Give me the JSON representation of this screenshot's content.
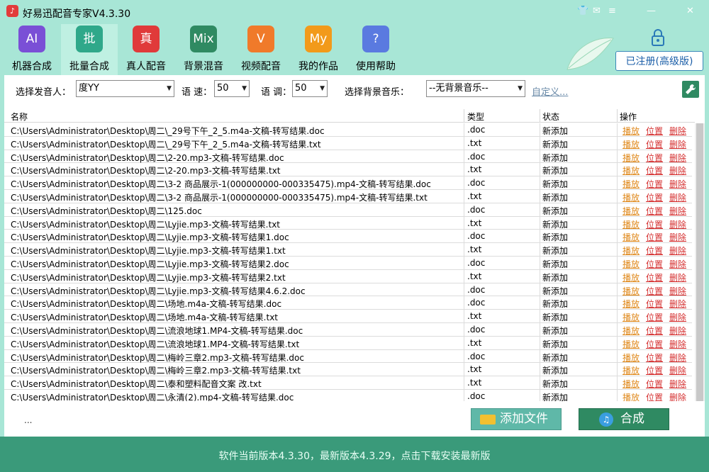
{
  "app": {
    "title": "好易迅配音专家V4.3.30"
  },
  "window_controls": [
    "👕",
    "✉",
    "≡",
    "—",
    "✕"
  ],
  "toolbar": [
    {
      "icon": "AI",
      "label": "机器合成",
      "color": "#7a4fd6"
    },
    {
      "icon": "批",
      "label": "批量合成",
      "color": "#2fa88a",
      "active": true
    },
    {
      "icon": "真",
      "label": "真人配音",
      "color": "#e03a3a"
    },
    {
      "icon": "Mix",
      "label": "背景混音",
      "color": "#2f8a62"
    },
    {
      "icon": "V",
      "label": "视频配音",
      "color": "#f07a2a"
    },
    {
      "icon": "My",
      "label": "我的作品",
      "color": "#f29a1a"
    },
    {
      "icon": "?",
      "label": "使用帮助",
      "color": "#5a7ae0"
    }
  ],
  "register_button": "已注册(高级版)",
  "settings": {
    "speaker_label": "选择发音人：",
    "speaker_value": "度YY",
    "speed_label": "语 速：",
    "speed_value": "50",
    "pitch_label": "语 调：",
    "pitch_value": "50",
    "bgm_label": "选择背景音乐：",
    "bgm_value": "--无背景音乐--",
    "custom_link": "自定义..."
  },
  "table": {
    "headers": [
      "名称",
      "类型",
      "状态",
      "操作"
    ],
    "ops": {
      "play": "播放",
      "locate": "位置",
      "delete": "删除"
    },
    "rows": [
      {
        "name": "C:\\Users\\Administrator\\Desktop\\周二\\_29号下午_2_5.m4a-文稿-转写结果.doc",
        "type": ".doc",
        "status": "新添加"
      },
      {
        "name": "C:\\Users\\Administrator\\Desktop\\周二\\_29号下午_2_5.m4a-文稿-转写结果.txt",
        "type": ".txt",
        "status": "新添加"
      },
      {
        "name": "C:\\Users\\Administrator\\Desktop\\周二\\2-20.mp3-文稿-转写结果.doc",
        "type": ".doc",
        "status": "新添加"
      },
      {
        "name": "C:\\Users\\Administrator\\Desktop\\周二\\2-20.mp3-文稿-转写结果.txt",
        "type": ".txt",
        "status": "新添加"
      },
      {
        "name": "C:\\Users\\Administrator\\Desktop\\周二\\3-2 商品展示-1(000000000-000335475).mp4-文稿-转写结果.doc",
        "type": ".doc",
        "status": "新添加"
      },
      {
        "name": "C:\\Users\\Administrator\\Desktop\\周二\\3-2 商品展示-1(000000000-000335475).mp4-文稿-转写结果.txt",
        "type": ".txt",
        "status": "新添加"
      },
      {
        "name": "C:\\Users\\Administrator\\Desktop\\周二\\125.doc",
        "type": ".doc",
        "status": "新添加"
      },
      {
        "name": "C:\\Users\\Administrator\\Desktop\\周二\\Lyjie.mp3-文稿-转写结果.txt",
        "type": ".txt",
        "status": "新添加"
      },
      {
        "name": "C:\\Users\\Administrator\\Desktop\\周二\\Lyjie.mp3-文稿-转写结果1.doc",
        "type": ".doc",
        "status": "新添加"
      },
      {
        "name": "C:\\Users\\Administrator\\Desktop\\周二\\Lyjie.mp3-文稿-转写结果1.txt",
        "type": ".txt",
        "status": "新添加"
      },
      {
        "name": "C:\\Users\\Administrator\\Desktop\\周二\\Lyjie.mp3-文稿-转写结果2.doc",
        "type": ".doc",
        "status": "新添加"
      },
      {
        "name": "C:\\Users\\Administrator\\Desktop\\周二\\Lyjie.mp3-文稿-转写结果2.txt",
        "type": ".txt",
        "status": "新添加"
      },
      {
        "name": "C:\\Users\\Administrator\\Desktop\\周二\\Lyjie.mp3-文稿-转写结果4.6.2.doc",
        "type": ".doc",
        "status": "新添加"
      },
      {
        "name": "C:\\Users\\Administrator\\Desktop\\周二\\场地.m4a-文稿-转写结果.doc",
        "type": ".doc",
        "status": "新添加"
      },
      {
        "name": "C:\\Users\\Administrator\\Desktop\\周二\\场地.m4a-文稿-转写结果.txt",
        "type": ".txt",
        "status": "新添加"
      },
      {
        "name": "C:\\Users\\Administrator\\Desktop\\周二\\流浪地球1.MP4-文稿-转写结果.doc",
        "type": ".doc",
        "status": "新添加"
      },
      {
        "name": "C:\\Users\\Administrator\\Desktop\\周二\\流浪地球1.MP4-文稿-转写结果.txt",
        "type": ".txt",
        "status": "新添加"
      },
      {
        "name": "C:\\Users\\Administrator\\Desktop\\周二\\梅岭三章2.mp3-文稿-转写结果.doc",
        "type": ".doc",
        "status": "新添加"
      },
      {
        "name": "C:\\Users\\Administrator\\Desktop\\周二\\梅岭三章2.mp3-文稿-转写结果.txt",
        "type": ".txt",
        "status": "新添加"
      },
      {
        "name": "C:\\Users\\Administrator\\Desktop\\周二\\泰和塑料配音文案 改.txt",
        "type": ".txt",
        "status": "新添加"
      },
      {
        "name": "C:\\Users\\Administrator\\Desktop\\周二\\永清(2).mp4-文稿-转写结果.doc",
        "type": ".doc",
        "status": "新添加"
      }
    ]
  },
  "bottom": {
    "ellipsis": "...",
    "add_file": "添加文件",
    "synthesize": "合成"
  },
  "status_bar": "软件当前版本4.3.30，最新版本4.3.29，点击下载安装最新版"
}
